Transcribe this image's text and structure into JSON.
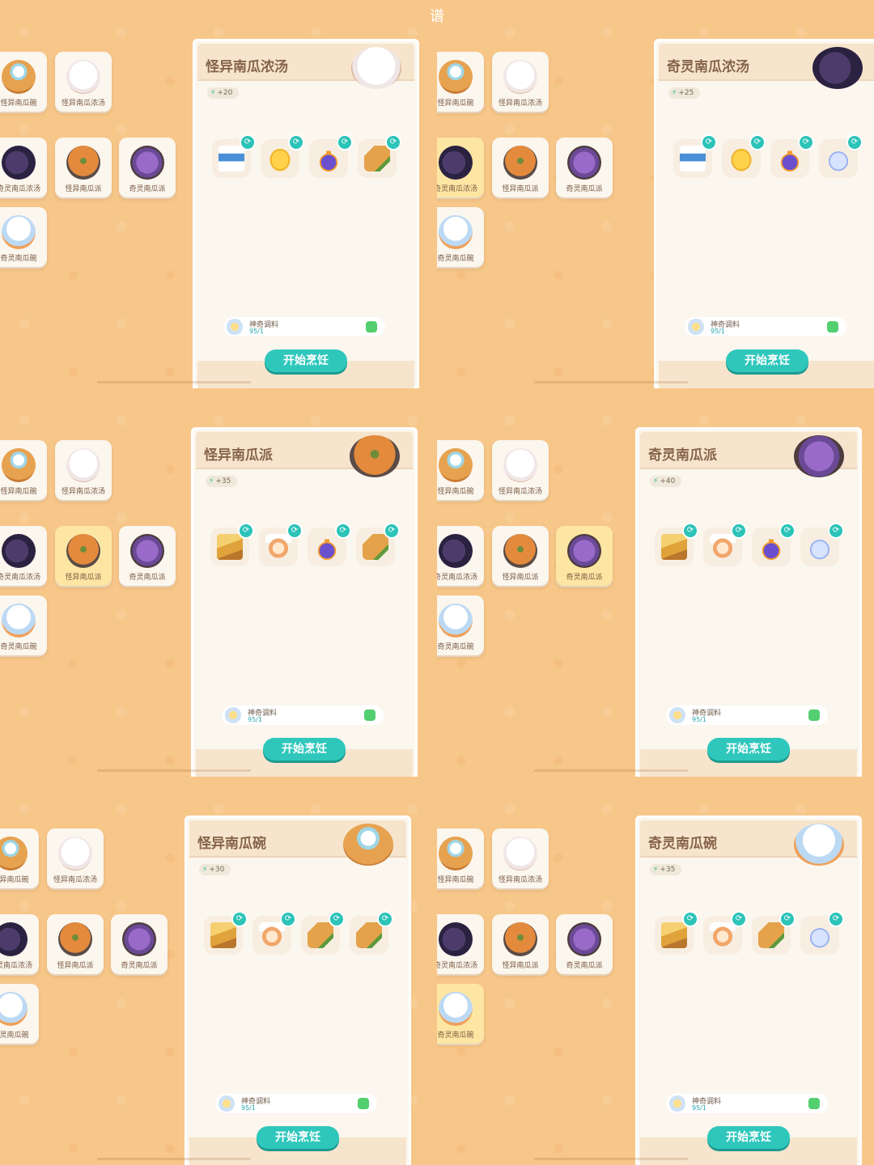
{
  "screen_title": "谱",
  "dishes": [
    {
      "label": "怪异南瓜碗",
      "art": "bowl"
    },
    {
      "label": "怪异南瓜浓汤",
      "art": "soupw"
    },
    {
      "label": "奇灵南瓜浓汤",
      "art": "souppurple"
    },
    {
      "label": "怪异南瓜派",
      "art": "pie"
    },
    {
      "label": "奇灵南瓜派",
      "art": "piepurple"
    },
    {
      "label": "奇灵南瓜碗",
      "art": "ghost"
    }
  ],
  "panels": [
    {
      "recipe_name": "怪异南瓜浓汤",
      "energy": "+20",
      "selected_index": -1,
      "hero": "soupw",
      "ingredients": [
        "milk",
        "butter",
        "potion",
        "carrot"
      ],
      "season_name": "神奇调料",
      "season_count": "95/1",
      "cook_label": "开始烹饪"
    },
    {
      "recipe_name": "奇灵南瓜浓汤",
      "energy": "+25",
      "selected_index": 2,
      "hero": "souppurple",
      "ingredients": [
        "milk",
        "butter",
        "potion",
        "ghostjar"
      ],
      "season_name": "神奇调料",
      "season_count": "95/1",
      "cook_label": "开始烹饪"
    },
    {
      "recipe_name": "怪异南瓜派",
      "energy": "+35",
      "selected_index": 3,
      "hero": "pie",
      "ingredients": [
        "wheat",
        "egg",
        "potion",
        "carrot"
      ],
      "season_name": "神奇调料",
      "season_count": "95/1",
      "cook_label": "开始烹饪"
    },
    {
      "recipe_name": "奇灵南瓜派",
      "energy": "+40",
      "selected_index": 4,
      "hero": "piepurple",
      "ingredients": [
        "wheat",
        "egg",
        "potion",
        "ghostjar"
      ],
      "season_name": "神奇调料",
      "season_count": "95/1",
      "cook_label": "开始烹饪"
    },
    {
      "recipe_name": "怪异南瓜碗",
      "energy": "+30",
      "selected_index": -1,
      "hero": "bowl",
      "ingredients": [
        "wheat",
        "egg",
        "carrot",
        "carrot"
      ],
      "season_name": "神奇调料",
      "season_count": "95/1",
      "cook_label": "开始烹饪"
    },
    {
      "recipe_name": "奇灵南瓜碗",
      "energy": "+35",
      "selected_index": 5,
      "hero": "ghost",
      "ingredients": [
        "wheat",
        "egg",
        "carrot",
        "ghostjar"
      ],
      "season_name": "神奇调料",
      "season_count": "95/1",
      "cook_label": "开始烹饪"
    }
  ],
  "icons": {
    "energy": "lightning-bolt-icon",
    "swap": "refresh-icon",
    "seasoning": "seasoning-jar-icon"
  },
  "colors": {
    "background": "#f7c689",
    "cook_button": "#2fc7bc",
    "selected_dish": "#fde6a3",
    "toggle_on": "#53cf70"
  }
}
